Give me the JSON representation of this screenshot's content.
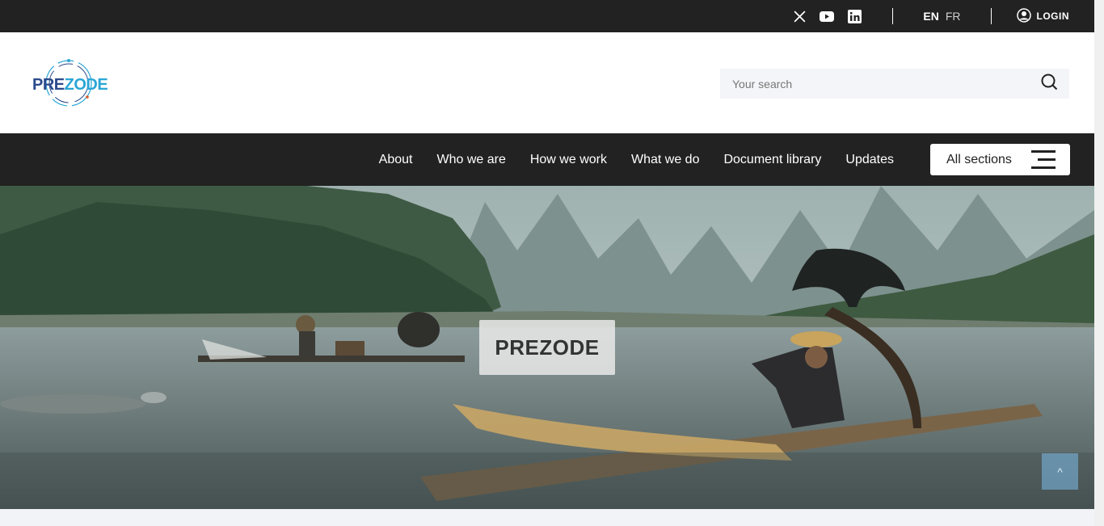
{
  "topbar": {
    "social": [
      {
        "name": "x-icon"
      },
      {
        "name": "youtube-icon"
      },
      {
        "name": "linkedin-icon"
      }
    ],
    "lang_en": "EN",
    "lang_fr": "FR",
    "login_label": "LOGIN"
  },
  "header": {
    "logo_part1": "PRE",
    "logo_part2": "ZODE",
    "search_placeholder": "Your search"
  },
  "nav": {
    "items": [
      "About",
      "Who we are",
      "How we work",
      "What we do",
      "Document library",
      "Updates"
    ],
    "all_sections_label": "All sections"
  },
  "hero": {
    "title": "PREZODE",
    "scroll_top_label": "^"
  },
  "colors": {
    "dark_bar": "#222222",
    "logo_dark": "#2b4a8c",
    "logo_light": "#2aa6d6"
  }
}
